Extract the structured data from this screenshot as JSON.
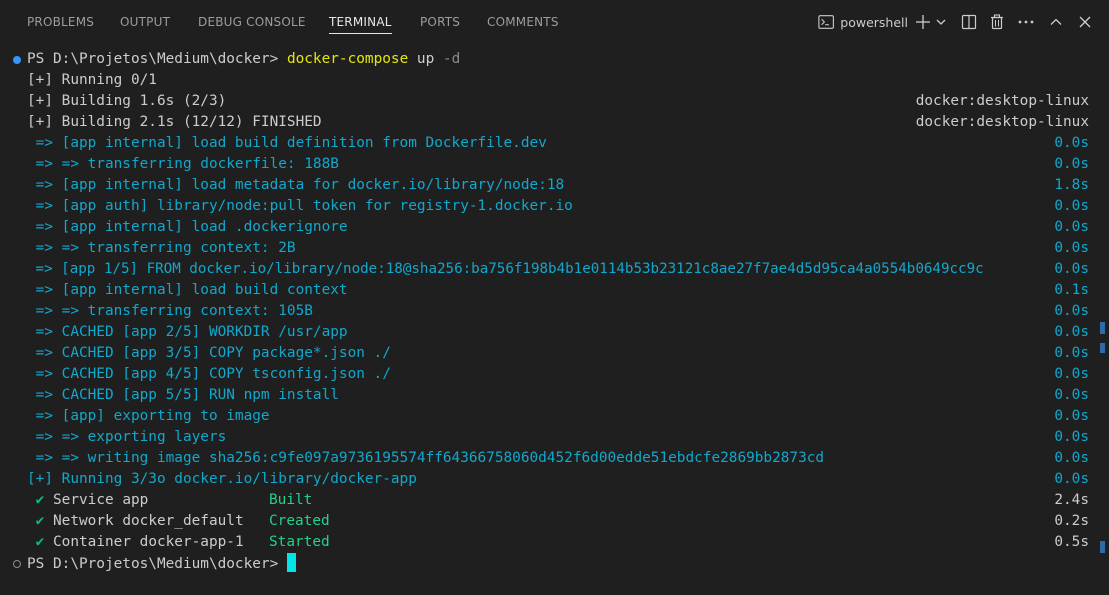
{
  "tabs": [
    {
      "label": "PROBLEMS",
      "active": false
    },
    {
      "label": "OUTPUT",
      "active": false
    },
    {
      "label": "DEBUG CONSOLE",
      "active": false
    },
    {
      "label": "TERMINAL",
      "active": true
    },
    {
      "label": "PORTS",
      "active": false
    },
    {
      "label": "COMMENTS",
      "active": false
    }
  ],
  "toolbar": {
    "shell_name": "powershell",
    "icons": [
      "terminal-icon",
      "plus-icon",
      "chevron-down-icon",
      "split-icon",
      "trash-icon",
      "more-icon",
      "chevron-up-icon",
      "close-icon"
    ]
  },
  "terminal": {
    "prompt": "PS D:\\Projetos\\Medium\\docker>",
    "command": "docker-compose",
    "command_arg": "up",
    "command_flag": "-d",
    "lines": [
      {
        "text": "[+] Running 0/1",
        "right": ""
      },
      {
        "text": "[+] Building 1.6s (2/3)",
        "right": "docker:desktop-linux"
      },
      {
        "text": "[+] Building 2.1s (12/12) FINISHED",
        "right": "docker:desktop-linux"
      },
      {
        "text": " => [app internal] load build definition from Dockerfile.dev",
        "right": "0.0s"
      },
      {
        "text": " => => transferring dockerfile: 188B",
        "right": "0.0s"
      },
      {
        "text": " => [app internal] load metadata for docker.io/library/node:18",
        "right": "1.8s"
      },
      {
        "text": " => [app auth] library/node:pull token for registry-1.docker.io",
        "right": "0.0s"
      },
      {
        "text": " => [app internal] load .dockerignore",
        "right": "0.0s"
      },
      {
        "text": " => => transferring context: 2B",
        "right": "0.0s"
      },
      {
        "text": " => [app 1/5] FROM docker.io/library/node:18@sha256:ba756f198b4b1e0114b53b23121c8ae27f7ae4d5d95ca4a0554b0649cc9c",
        "right": "0.0s"
      },
      {
        "text": " => [app internal] load build context",
        "right": "0.1s"
      },
      {
        "text": " => => transferring context: 105B",
        "right": "0.0s"
      },
      {
        "text": " => CACHED [app 2/5] WORKDIR /usr/app",
        "right": "0.0s"
      },
      {
        "text": " => CACHED [app 3/5] COPY package*.json ./",
        "right": "0.0s"
      },
      {
        "text": " => CACHED [app 4/5] COPY tsconfig.json ./",
        "right": "0.0s"
      },
      {
        "text": " => CACHED [app 5/5] RUN npm install",
        "right": "0.0s"
      },
      {
        "text": " => [app] exporting to image",
        "right": "0.0s"
      },
      {
        "text": " => => exporting layers",
        "right": "0.0s"
      },
      {
        "text": " => => writing image sha256:c9fe097a9736195574ff64366758060d452f6d00edde51ebdcfe2869bb2873cd",
        "right": "0.0s"
      },
      {
        "text": "[+] Running 3/3o docker.io/library/docker-app",
        "right": "0.0s"
      }
    ],
    "services": [
      {
        "check": "✔",
        "name": "Service app",
        "status": "Built",
        "time": "2.4s"
      },
      {
        "check": "✔",
        "name": "Network docker_default",
        "status": "Created",
        "time": "0.2s"
      },
      {
        "check": "✔",
        "name": "Container docker-app-1",
        "status": "Started",
        "time": "0.5s"
      }
    ]
  },
  "colors": {
    "background": "#1f1f1f",
    "text": "#cccccc",
    "cyan": "#11a8cd",
    "yellow": "#e5e510",
    "green": "#23d18b",
    "cursor": "#00e5e5",
    "accent_blue": "#3794ff"
  }
}
